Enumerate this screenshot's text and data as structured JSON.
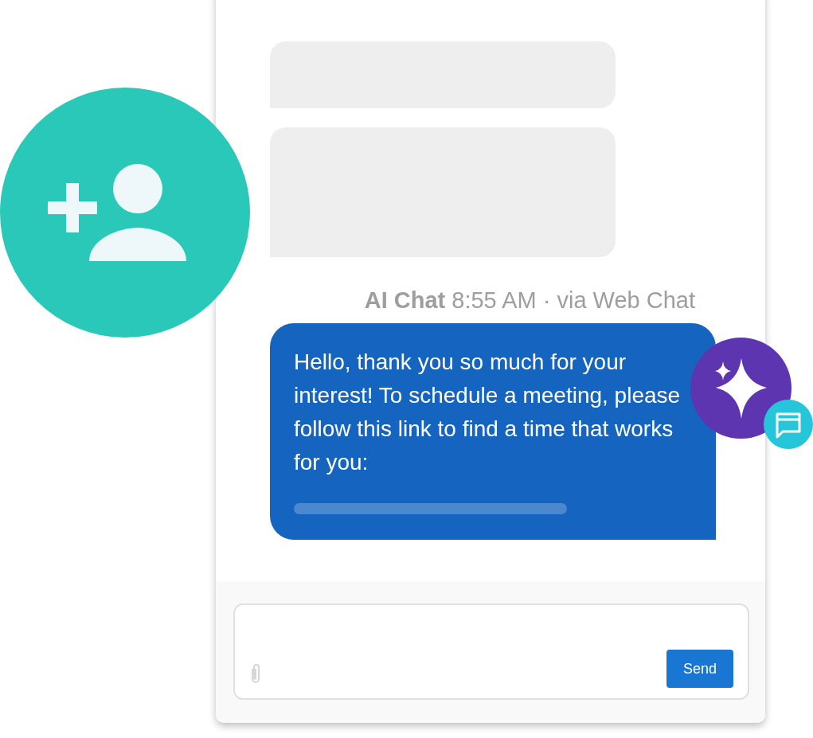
{
  "message": {
    "meta": "**AI Chat** 8:55 AM · via Web Chat",
    "text": "Hello, thank you so much for your interest! To schedule a meeting, please follow this link to find a time that works for you:"
  },
  "composer": {
    "send_label": "Send"
  }
}
